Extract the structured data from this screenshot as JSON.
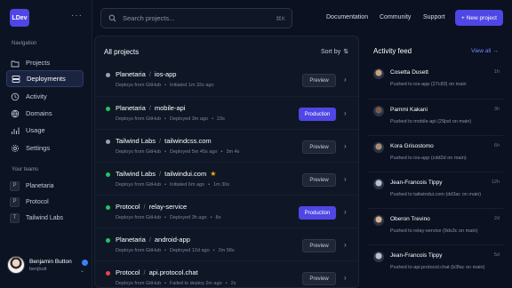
{
  "app": {
    "logo_text": "LDev"
  },
  "sidebar": {
    "nav_label": "Navigation",
    "items": [
      {
        "label": "Projects",
        "icon": "folder-icon"
      },
      {
        "label": "Deployments",
        "icon": "server-icon",
        "active": true
      },
      {
        "label": "Activity",
        "icon": "activity-icon"
      },
      {
        "label": "Domains",
        "icon": "globe-icon"
      },
      {
        "label": "Usage",
        "icon": "chart-icon"
      },
      {
        "label": "Settings",
        "icon": "gear-icon"
      }
    ],
    "teams_label": "Your teams",
    "teams": [
      {
        "initial": "P",
        "label": "Planetaria"
      },
      {
        "initial": "P",
        "label": "Protocol"
      },
      {
        "initial": "T",
        "label": "Tailwind Labs"
      }
    ],
    "user": {
      "name": "Benjamin Button",
      "handle": "benjbutt"
    }
  },
  "topbar": {
    "search_placeholder": "Search projects...",
    "shortcut": "⌘K",
    "links": [
      "Documentation",
      "Community",
      "Support"
    ],
    "new_button": "+ New project"
  },
  "projects": {
    "title": "All projects",
    "sort_label": "Sort by",
    "rows": [
      {
        "team": "Planetaria",
        "name": "ios-app",
        "status": "#9ca3af",
        "source": "Deploys from GitHub",
        "detail": "Initiated 1m 32s ago",
        "extra": "",
        "button": "Preview",
        "starred": false
      },
      {
        "team": "Planetaria",
        "name": "mobile-api",
        "status": "#22c55e",
        "source": "Deploys from GitHub",
        "detail": "Deployed 3m ago",
        "extra": "23s",
        "button": "Production",
        "starred": false
      },
      {
        "team": "Tailwind Labs",
        "name": "tailwindcss.com",
        "status": "#9ca3af",
        "source": "Deploys from GitHub",
        "detail": "Deployed 5m 45s ago",
        "extra": "3m 4s",
        "button": "Preview",
        "starred": false
      },
      {
        "team": "Tailwind Labs",
        "name": "tailwindui.com",
        "status": "#22c55e",
        "source": "Deploys from GitHub",
        "detail": "Initiated 6m ago",
        "extra": "1m 30s",
        "button": "Preview",
        "starred": true
      },
      {
        "team": "Protocol",
        "name": "relay-service",
        "status": "#22c55e",
        "source": "Deploys from GitHub",
        "detail": "Deployed 3h ago",
        "extra": "8s",
        "button": "Production",
        "starred": false
      },
      {
        "team": "Planetaria",
        "name": "android-app",
        "status": "#22c55e",
        "source": "Deploys from GitHub",
        "detail": "Deployed 12d ago",
        "extra": "2m 58s",
        "button": "Preview",
        "starred": false
      },
      {
        "team": "Protocol",
        "name": "api.protocol.chat",
        "status": "#ef4444",
        "source": "Deploys from GitHub",
        "detail": "Failed to deploy 2m ago",
        "extra": "2s",
        "button": "Preview",
        "starred": false
      }
    ]
  },
  "activity": {
    "title": "Activity feed",
    "view_all": "View all →",
    "items": [
      {
        "name": "Cosetta Dusett",
        "time": "1h",
        "desc": "Pushed to ios-app (27c83) on main",
        "avatar": "#c9a27e"
      },
      {
        "name": "Pammi Kakani",
        "time": "3h",
        "desc": "Pushed to mobile-api (29jsd on main)",
        "avatar": "#7b5a4a"
      },
      {
        "name": "Kora Grisostomo",
        "time": "6h",
        "desc": "Pushed to ios-app (cdd2d on main)",
        "avatar": "#a98c74"
      },
      {
        "name": "Jean-Francois Tippy",
        "time": "12h",
        "desc": "Pushed to tailwindui.com (dd3ac on main)",
        "avatar": "#b7c2cc"
      },
      {
        "name": "Oberon Trevino",
        "time": "2d",
        "desc": "Pushed to relay-service (9ds3c on main)",
        "avatar": "#d6b08e"
      },
      {
        "name": "Jean-Francois Tippy",
        "time": "5d",
        "desc": "Pushed to api.protocol.chat (b3fac on main)",
        "avatar": "#b7c2cc"
      }
    ]
  },
  "colors": {
    "accent": "#4f46e5",
    "link": "#6b8cff",
    "background": "#0b1120"
  }
}
